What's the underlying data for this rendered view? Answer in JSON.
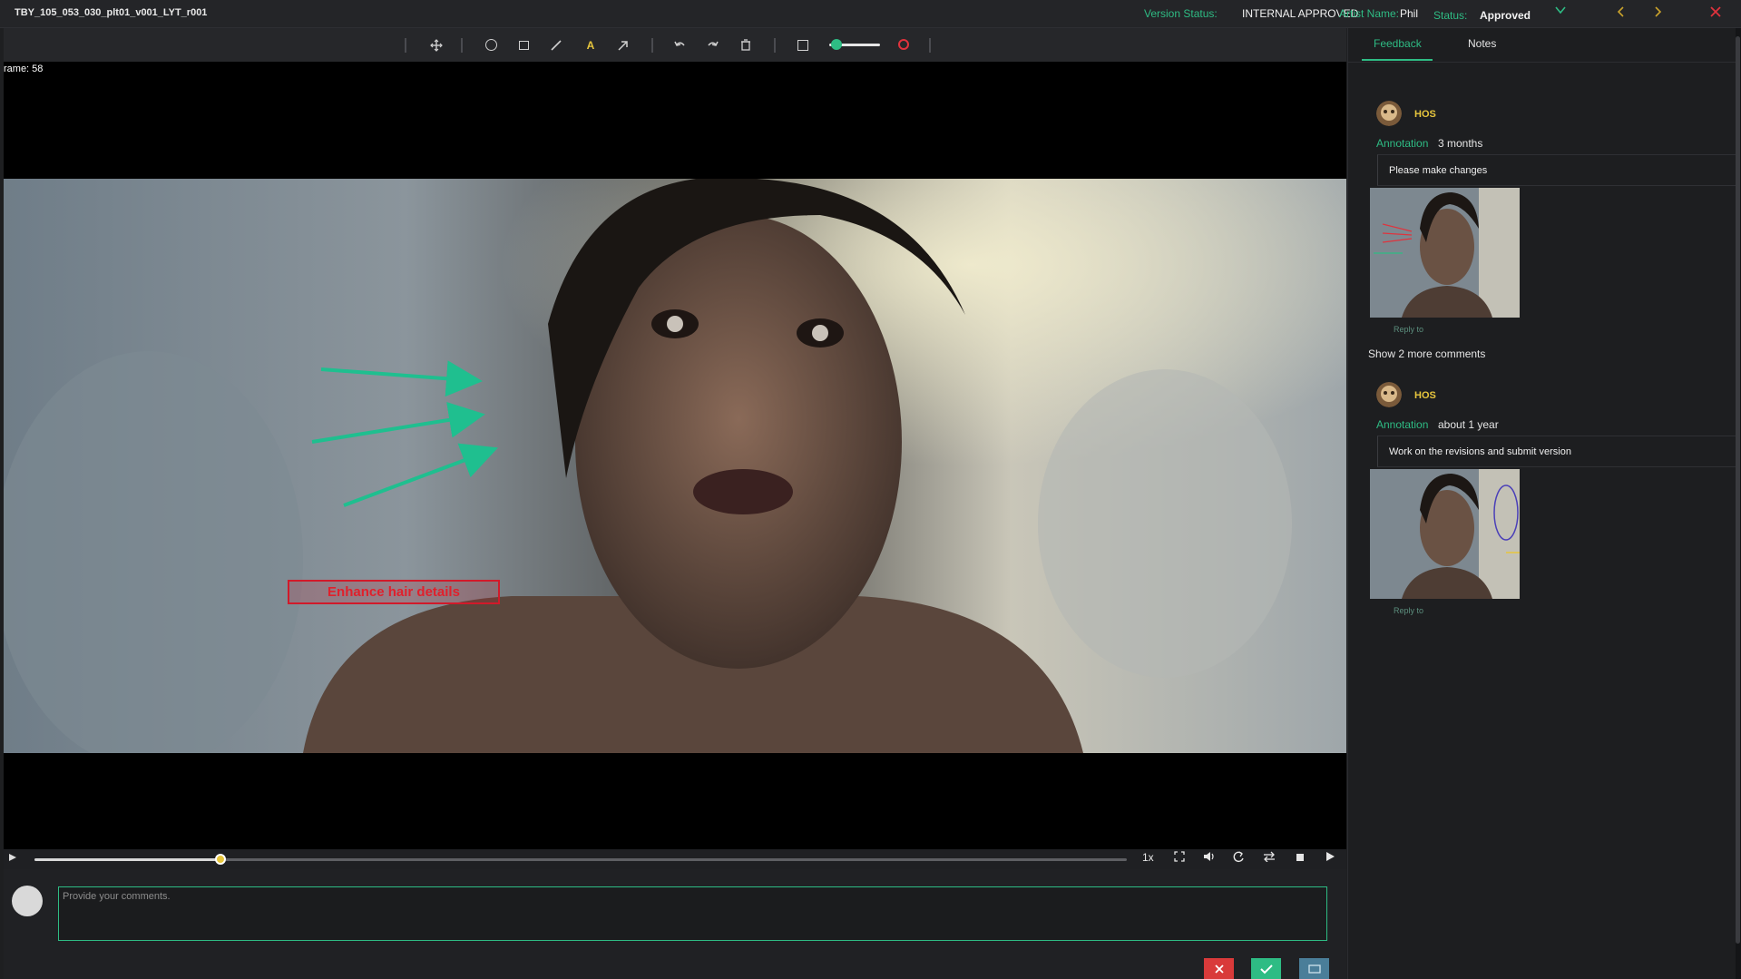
{
  "header": {
    "shot_title": "TBY_105_053_030_plt01_v001_LYT_r001",
    "version_status_label": "Version Status:",
    "version_status_value": "INTERNAL APPROVED",
    "artist_label": "Artist Name:",
    "artist_value": "Phil",
    "status_label": "Status:",
    "status_value": "Approved",
    "chevron_icon": "chevron-down-icon",
    "prev_icon": "chevron-left-icon",
    "next_icon": "chevron-right-icon",
    "close_icon": "close-icon"
  },
  "toolbar": {
    "tools": [
      "move-icon",
      "circle-icon",
      "rectangle-icon",
      "pen-icon",
      "text-icon",
      "arrow-icon",
      "undo-icon",
      "redo-icon",
      "trash-icon",
      "box-icon",
      "brush-size-slider",
      "color-picker"
    ],
    "text_tool_glyph": "A",
    "accent_color": "#2ebc84",
    "annotation_color": "#e0333d"
  },
  "viewer": {
    "frame_label": "rame: 58",
    "annotation_text": "Enhance hair details",
    "arrow_color": "#1fbf8f"
  },
  "playback": {
    "progress": 0.17,
    "speed_label": "1x"
  },
  "composer": {
    "placeholder": "Provide your comments."
  },
  "panel": {
    "tabs": [
      {
        "label": "Feedback",
        "active": true
      },
      {
        "label": "Notes",
        "active": false
      }
    ],
    "comments": [
      {
        "author": "HOS",
        "type": "Annotation",
        "time": "3 months",
        "body": "Please make changes",
        "reply": "Reply to"
      },
      {
        "author": "HOS",
        "type": "Annotation",
        "time": "about 1 year",
        "body": "Work on the revisions and submit version",
        "reply": "Reply to"
      }
    ],
    "show_more": "Show 2 more comments"
  }
}
